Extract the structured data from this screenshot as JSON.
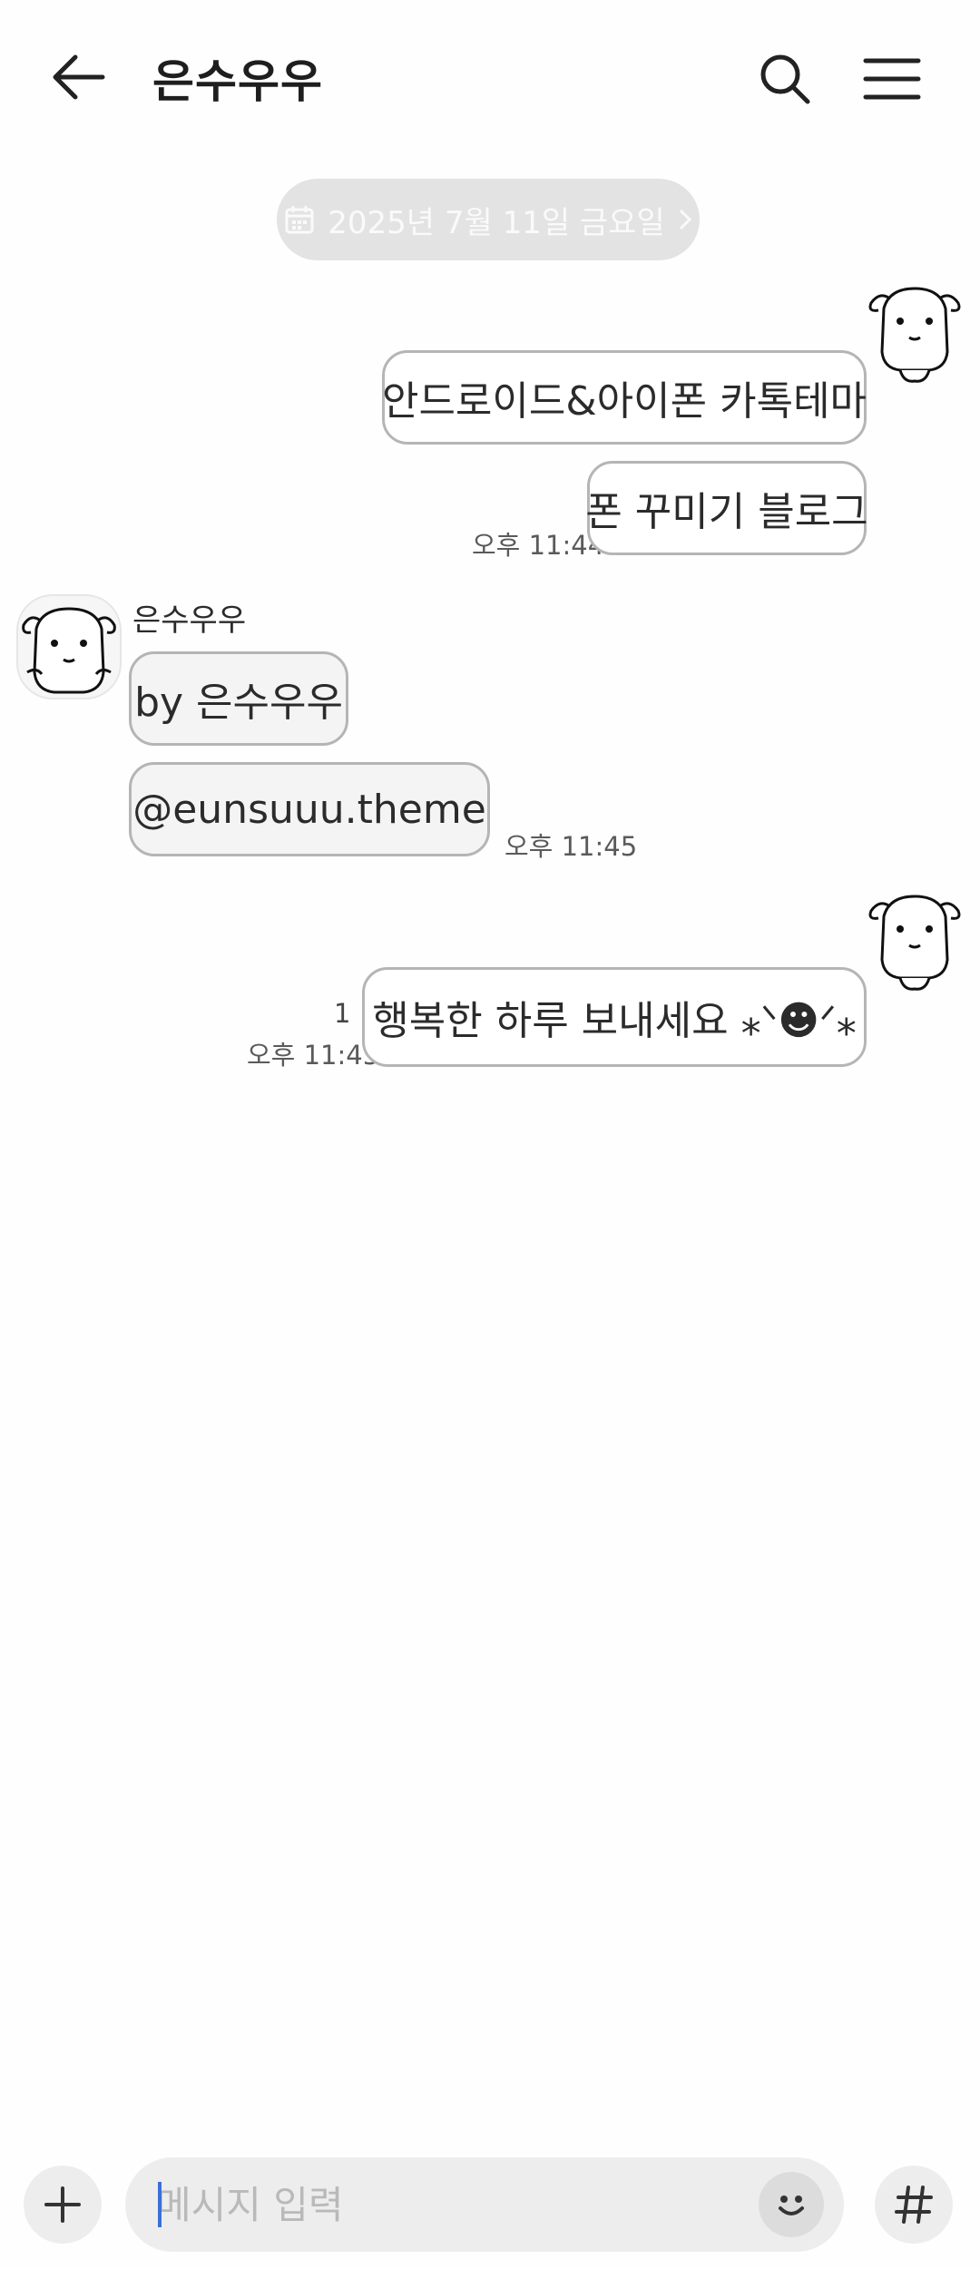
{
  "header": {
    "title": "은수우우",
    "back_icon": "arrow-left-icon",
    "search_icon": "search-icon",
    "menu_icon": "hamburger-menu-icon"
  },
  "date_divider": {
    "label": "2025년 7월 11일 금요일",
    "icon": "calendar-icon",
    "chevron": "chevron-right-icon"
  },
  "messages": [
    {
      "direction": "out",
      "text": "안드로이드&아이폰 카톡테마"
    },
    {
      "direction": "out",
      "text": "폰 꾸미기 블로그",
      "time": "오후 11:44"
    },
    {
      "direction": "in",
      "sender": "은수우우",
      "text": "by 은수우우"
    },
    {
      "direction": "in",
      "text": "@eunsuuu.theme",
      "time": "오후 11:45"
    },
    {
      "direction": "out",
      "text": "행복한 하루 보내세요 ⁎ᐠ☻ᐟ⁎",
      "time": "오후 11:45",
      "unread": "1"
    }
  ],
  "input_bar": {
    "placeholder": "메시지 입력",
    "value": "",
    "plus_icon": "plus-icon",
    "emoji_icon": "smiley-icon",
    "hash_icon": "hash-icon"
  },
  "colors": {
    "background": "#fefefe",
    "bubble_border": "#b5b5b5",
    "incoming_bubble": "#f4f4f4",
    "date_pill": "#e3e3e3",
    "input_bg": "#ededed",
    "caret": "#3a6fd8"
  }
}
